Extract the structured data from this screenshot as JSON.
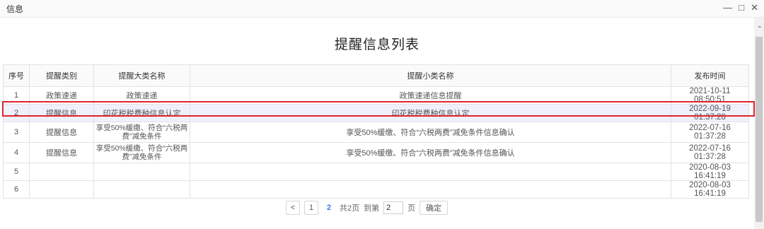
{
  "window": {
    "title": "信息",
    "minimize_icon": "minimize-icon",
    "restore_icon": "restore-icon",
    "close_icon": "close-icon"
  },
  "page_title": "提醒信息列表",
  "table": {
    "headers": [
      "序号",
      "提醒类别",
      "提醒大类名称",
      "提醒小类名称",
      "发布时间"
    ],
    "rows": [
      {
        "no": "1",
        "category": "政策速递",
        "major": "政策速递",
        "minor": "政策速递信息提醒",
        "time": "2021-10-11 08:50:51"
      },
      {
        "no": "2",
        "category": "提醒信息",
        "major": "印花税税费种信息认定",
        "minor": "印花税税费种信息认定",
        "time": "2022-09-19 01:37:28"
      },
      {
        "no": "3",
        "category": "提醒信息",
        "major": "享受50%缓缴、符合“六税两费”减免条件",
        "minor": "享受50%缓缴、符合“六税两费”减免条件信息确认",
        "time": "2022-07-16 01:37:28"
      },
      {
        "no": "4",
        "category": "提醒信息",
        "major": "享受50%缓缴、符合“六税两费”减免条件",
        "minor": "享受50%缓缴、符合“六税两费”减免条件信息确认",
        "time": "2022-07-16 01:37:28"
      },
      {
        "no": "5",
        "category": "",
        "major": "",
        "minor": "",
        "time": "2020-08-03 16:41:19"
      },
      {
        "no": "6",
        "category": "",
        "major": "",
        "minor": "",
        "time": "2020-08-03 16:41:19"
      }
    ],
    "selected_row": 2
  },
  "pagination": {
    "prev": "<",
    "page1": "1",
    "current": "2",
    "total_text": "共2页",
    "goto_label": "到第",
    "goto_value": "2",
    "page_suffix": "页",
    "confirm": "确定"
  },
  "colors": {
    "highlight": "#e0232e",
    "accent": "#2f7ff5"
  }
}
